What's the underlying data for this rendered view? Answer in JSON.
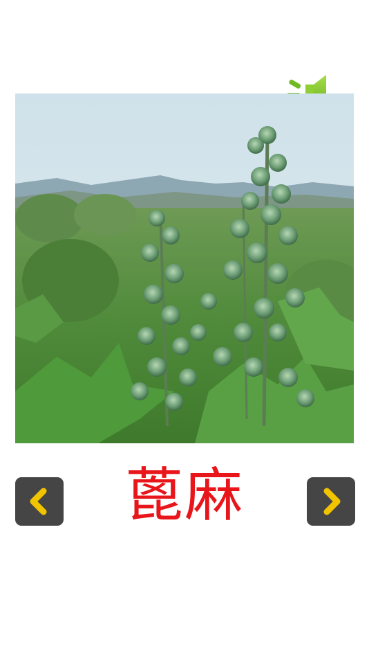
{
  "card": {
    "word": "蓖麻"
  },
  "icons": {
    "sound": "speaker-sound-icon",
    "prev": "chevron-left-icon",
    "next": "chevron-right-icon"
  },
  "colors": {
    "background": "#ffffff",
    "word": "#e8151b",
    "nav_button": "#454545",
    "chevron": "#f2c400",
    "sound_icon": "#7ec22a"
  }
}
